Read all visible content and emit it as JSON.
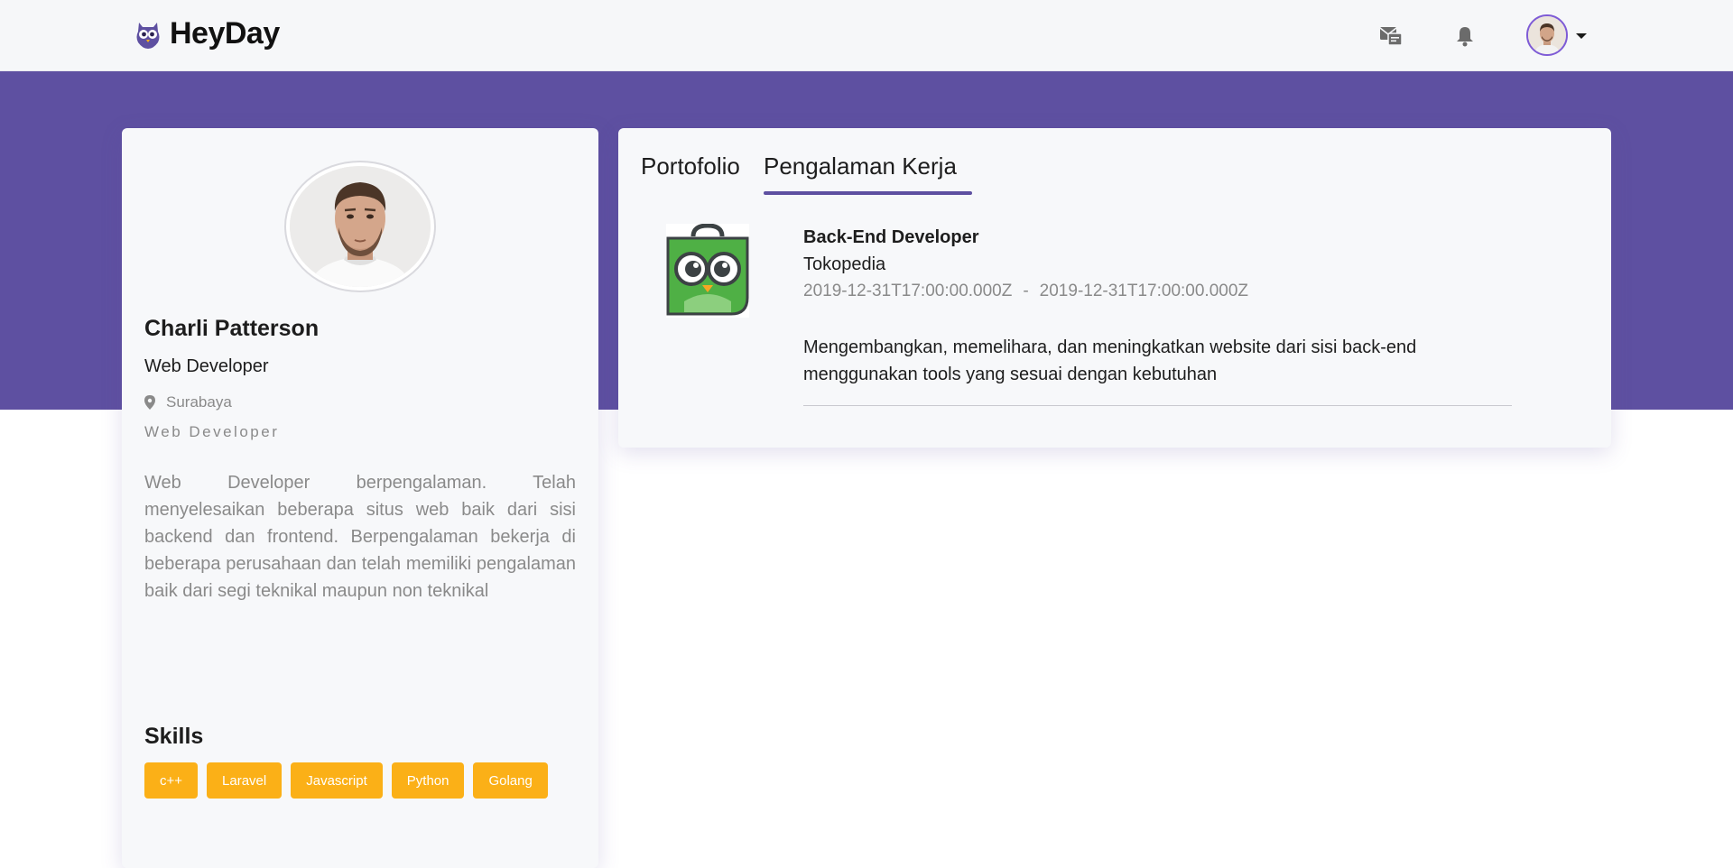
{
  "navbar": {
    "brand": "HeyDay",
    "icons": [
      "mail-icon",
      "bell-icon",
      "user-avatar",
      "caret-down-icon"
    ]
  },
  "profile": {
    "name": "Charli Patterson",
    "title": "Web Developer",
    "location": "Surabaya",
    "role": "Web Developer",
    "bio": "Web Developer berpengalaman. Telah menyelesaikan beberapa situs web baik dari sisi backend dan frontend. Berpengalaman bekerja di beberapa perusahaan dan telah memiliki pengalaman baik dari segi teknikal maupun non teknikal",
    "skills_title": "Skills",
    "skills": [
      "c++",
      "Laravel",
      "Javascript",
      "Python",
      "Golang"
    ]
  },
  "tabs": {
    "portfolio": "Portofolio",
    "work": "Pengalaman Kerja",
    "active": "work"
  },
  "experience": {
    "position": "Back-End Developer",
    "company": "Tokopedia",
    "start": "2019-12-31T17:00:00.000Z",
    "separator": "-",
    "end": "2019-12-31T17:00:00.000Z",
    "description": "Mengembangkan, memelihara, dan meningkatkan website dari sisi back-end menggunakan tools yang sesuai dengan kebutuhan"
  },
  "colors": {
    "brand": "#5e50a1",
    "skill_badge": "#fbb017",
    "logo_green": "#4fb045"
  }
}
